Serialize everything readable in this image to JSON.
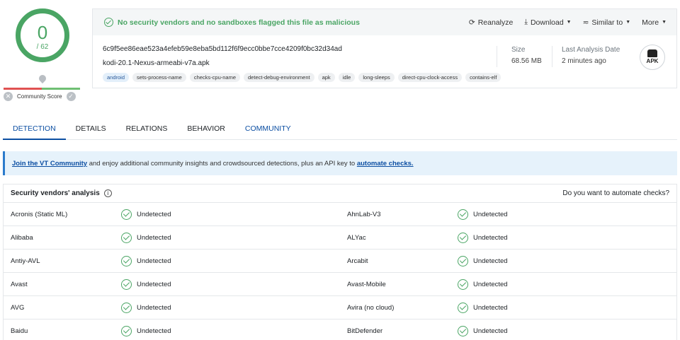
{
  "score": {
    "detections": "0",
    "total": "/ 62",
    "community_label": "Community Score"
  },
  "status": {
    "message": "No security vendors and no sandboxes flagged this file as malicious",
    "color": "#4aa564"
  },
  "actions": [
    {
      "label": "Reanalyze",
      "icon": "reload-icon"
    },
    {
      "label": "Download",
      "icon": "download-icon"
    },
    {
      "label": "Similar to",
      "icon": "similar-icon"
    },
    {
      "label": "More",
      "icon": ""
    }
  ],
  "file": {
    "hash": "6c9f5ee86eae523a4efeb59e8eba5bd112f6f9ecc0bbe7cce4209f0bc32d34ad",
    "name": "kodi-20.1-Nexus-armeabi-v7a.apk",
    "tags": [
      "android",
      "sets-process-name",
      "checks-cpu-name",
      "detect-debug-environment",
      "apk",
      "idle",
      "long-sleeps",
      "direct-cpu-clock-access",
      "contains-elf"
    ],
    "size_label": "Size",
    "size_value": "68.56 MB",
    "analysis_label": "Last Analysis Date",
    "analysis_value": "2 minutes ago",
    "type_badge": "APK"
  },
  "tabs": [
    "DETECTION",
    "DETAILS",
    "RELATIONS",
    "BEHAVIOR",
    "COMMUNITY"
  ],
  "banner": {
    "link1": "Join the VT Community",
    "text": " and enjoy additional community insights and crowdsourced detections, plus an API key to ",
    "link2": "automate checks."
  },
  "vendors": {
    "title": "Security vendors' analysis",
    "automate_prompt": "Do you want to automate checks?",
    "rows": [
      {
        "left": "Acronis (Static ML)",
        "left_result": "Undetected",
        "right": "AhnLab-V3",
        "right_result": "Undetected"
      },
      {
        "left": "Alibaba",
        "left_result": "Undetected",
        "right": "ALYac",
        "right_result": "Undetected"
      },
      {
        "left": "Antiy-AVL",
        "left_result": "Undetected",
        "right": "Arcabit",
        "right_result": "Undetected"
      },
      {
        "left": "Avast",
        "left_result": "Undetected",
        "right": "Avast-Mobile",
        "right_result": "Undetected"
      },
      {
        "left": "AVG",
        "left_result": "Undetected",
        "right": "Avira (no cloud)",
        "right_result": "Undetected"
      },
      {
        "left": "Baidu",
        "left_result": "Undetected",
        "right": "BitDefender",
        "right_result": "Undetected"
      }
    ]
  }
}
